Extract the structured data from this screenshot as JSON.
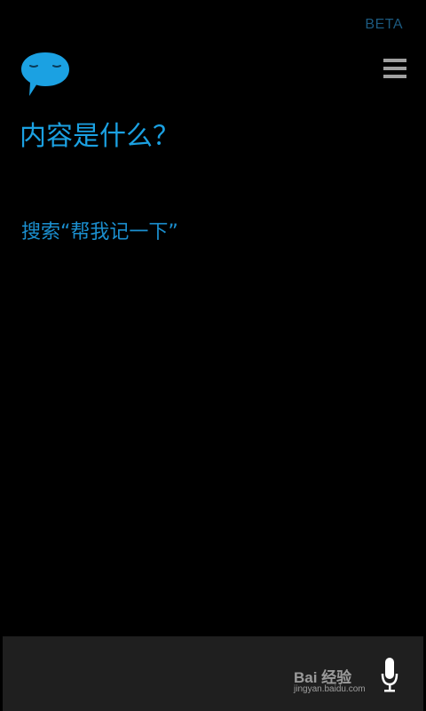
{
  "header": {
    "beta_label": "BETA"
  },
  "main": {
    "question": "内容是什么？",
    "suggestion": "搜索“帮我记一下”"
  },
  "watermark": {
    "brand": "Bai 经验",
    "url": "jingyan.baidu.com"
  },
  "colors": {
    "accent": "#1ba1e2",
    "background": "#000000",
    "bottom_bar": "#1f1f1f"
  },
  "icons": {
    "logo": "speech-bubble-face-icon",
    "menu": "hamburger-menu-icon",
    "mic": "microphone-icon"
  }
}
